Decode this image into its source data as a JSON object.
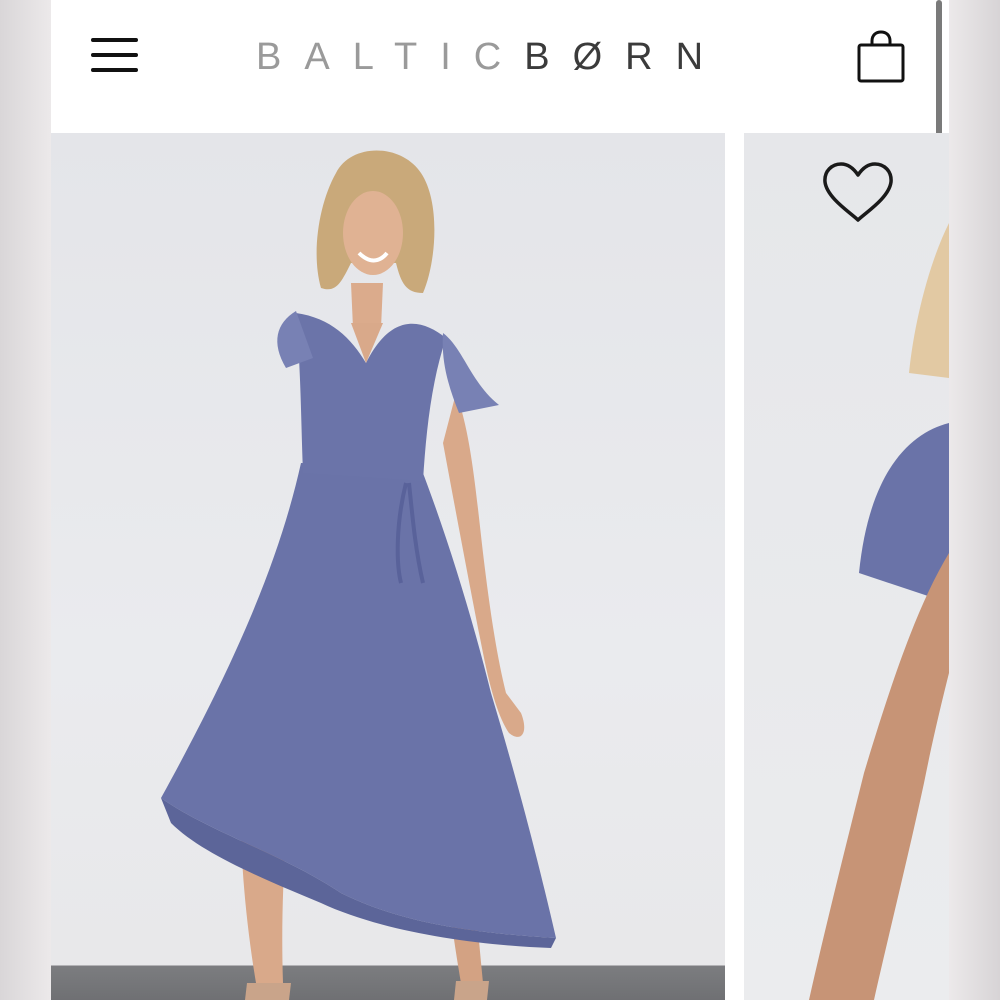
{
  "header": {
    "logo_part1": "BALTIC",
    "logo_part2": "BØRN",
    "menu_icon": "hamburger-menu-icon",
    "bag_icon": "shopping-bag-icon"
  },
  "product_carousel": {
    "favorite_icon": "heart-icon",
    "dress_color": "#6a73a8"
  },
  "colors": {
    "logo_light": "#9a9a9a",
    "logo_dark": "#3b3b3b",
    "icon": "#111111",
    "background": "#ffffff"
  }
}
